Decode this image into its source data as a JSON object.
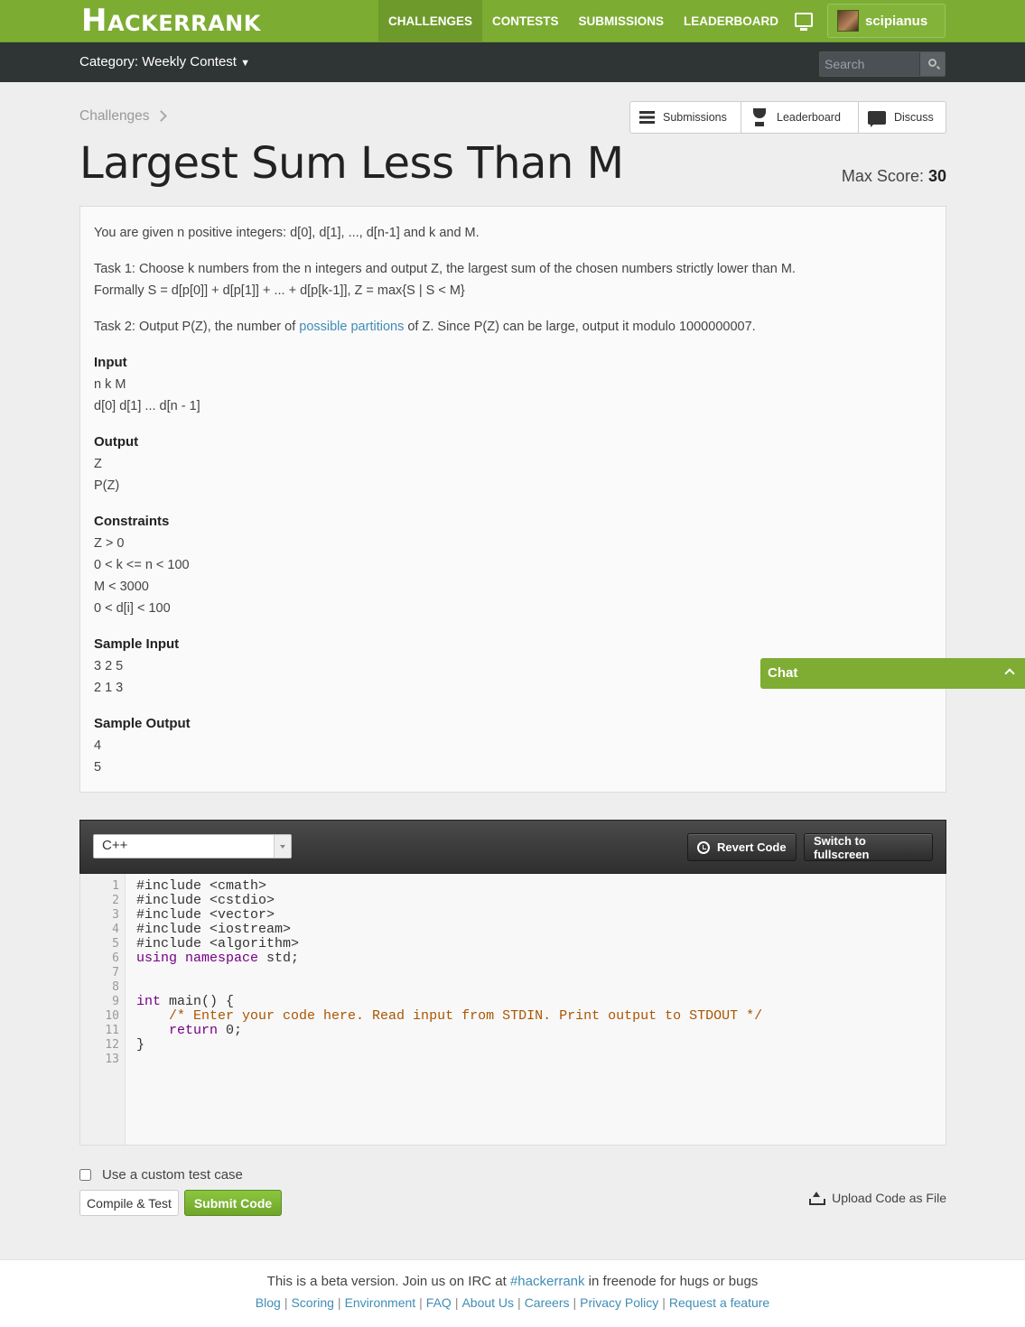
{
  "header": {
    "logo_h": "H",
    "logo_rest": "ACKERRANK",
    "nav": [
      "CHALLENGES",
      "CONTESTS",
      "SUBMISSIONS",
      "LEADERBOARD"
    ],
    "username": "scipianus"
  },
  "catbar": {
    "category": "Category: Weekly Contest",
    "search_placeholder": "Search"
  },
  "breadcrumb": "Challenges",
  "actions": [
    "Submissions",
    "Leaderboard",
    "Discuss"
  ],
  "title": "Largest Sum Less Than M",
  "max_score_label": "Max Score:",
  "max_score": "30",
  "statement": {
    "intro": "You are given n positive integers: d[0], d[1], ..., d[n-1] and k and M.",
    "task1_a": "Task 1: Choose k numbers from the n integers and output Z, the largest sum of the chosen numbers strictly lower than M.",
    "task1_b": "Formally S = d[p[0]] + d[p[1]] + ... + d[p[k-1]], Z = max{S | S < M}",
    "task2_pre": "Task 2: Output P(Z), the number of ",
    "task2_link": "possible partitions",
    "task2_post": " of Z. Since P(Z) can be large, output it modulo 1000000007.",
    "input_h": "Input",
    "input_lines": [
      "n k M",
      "d[0] d[1] ... d[n - 1]"
    ],
    "output_h": "Output",
    "output_lines": [
      "Z",
      "P(Z)"
    ],
    "constraints_h": "Constraints",
    "constraints_lines": [
      "Z > 0",
      "0 < k <= n < 100",
      "M < 3000",
      "0 < d[i] < 100"
    ],
    "sample_in_h": "Sample Input",
    "sample_in_lines": [
      "3 2 5",
      "2 1 3"
    ],
    "sample_out_h": "Sample Output",
    "sample_out_lines": [
      "4",
      "5"
    ]
  },
  "chat_label": "Chat",
  "editor": {
    "language": "C++",
    "revert_label": "Revert Code",
    "fullscreen_label": "Switch to fullscreen",
    "line_numbers": [
      "1",
      "2",
      "3",
      "4",
      "5",
      "6",
      "7",
      "8",
      "9",
      "10",
      "11",
      "12",
      "13"
    ],
    "code": {
      "l1": "#include <cmath>",
      "l2": "#include <cstdio>",
      "l3": "#include <vector>",
      "l4": "#include <iostream>",
      "l5": "#include <algorithm>",
      "l6_kw": "using namespace",
      "l6_rest": " std;",
      "l9_kw": "int",
      "l9_rest": " main() {",
      "l10_indent": "    ",
      "l10_cm": "/* Enter your code here. Read input from STDIN. Print output to STDOUT */",
      "l11_indent": "    ",
      "l11_kw": "return",
      "l11_rest": " 0;",
      "l12": "}"
    }
  },
  "controls": {
    "custom_label": "Use a custom test case",
    "compile_label": "Compile & Test",
    "submit_label": "Submit Code",
    "upload_label": "Upload Code as File"
  },
  "footer": {
    "beta_pre": "This is a beta version. Join us on IRC at ",
    "beta_link": "#hackerrank",
    "beta_post": " in freenode for hugs or bugs",
    "links": [
      "Blog",
      "Scoring",
      "Environment",
      "FAQ",
      "About Us",
      "Careers",
      "Privacy Policy",
      "Request a feature"
    ]
  }
}
